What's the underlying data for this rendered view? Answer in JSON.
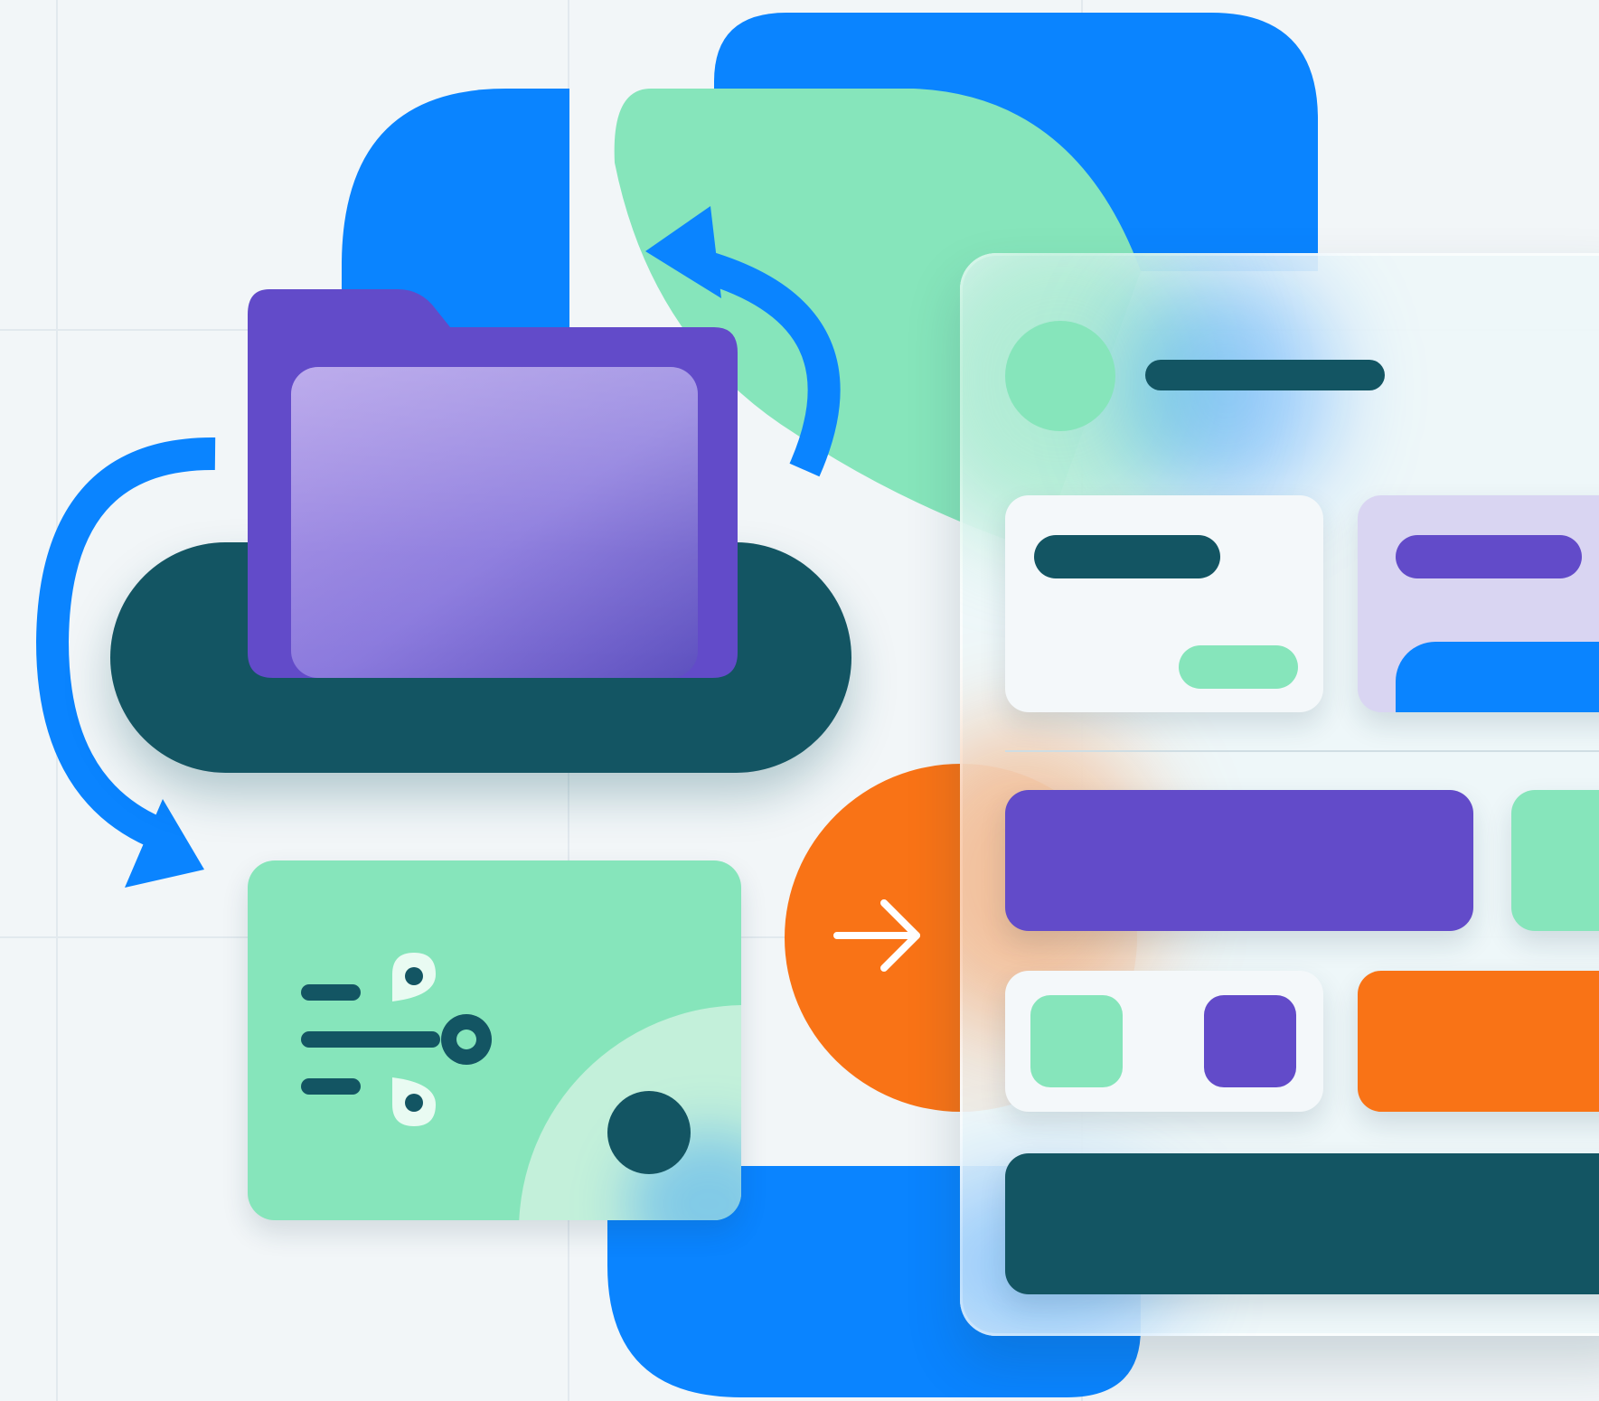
{
  "palette": {
    "blue": "#0a84ff",
    "mint": "#86e5bb",
    "mint_light": "#c3f0da",
    "teal_dark": "#135563",
    "purple": "#624bc9",
    "purple_light": "#d9d5f2",
    "orange": "#f97316",
    "panel": "#eef6f8",
    "background": "#f2f6f8"
  },
  "icons": {
    "folder": "folder-icon",
    "cycle_top": "curved-arrow-icon",
    "cycle_left": "curved-arrow-icon",
    "arrow_right": "arrow-right-icon",
    "flow": "flow-network-icon"
  }
}
